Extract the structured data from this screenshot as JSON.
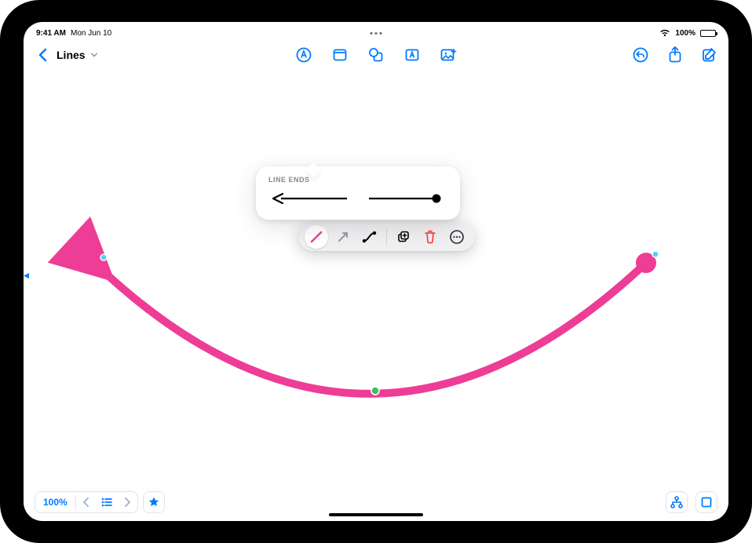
{
  "status": {
    "time": "9:41 AM",
    "date": "Mon Jun 10",
    "battery_pct": "100%"
  },
  "toolbar": {
    "back_label": "Back",
    "doc_title": "Lines"
  },
  "popover": {
    "title": "LINE ENDS"
  },
  "bottom": {
    "zoom": "100%"
  },
  "colors": {
    "accent": "#007aff",
    "stroke": "#ee3d96",
    "danger": "#ff3b30"
  }
}
